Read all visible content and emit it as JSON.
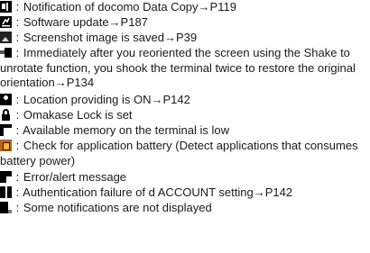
{
  "items": [
    {
      "icon": "docomo-data-copy-icon",
      "text": "Notification of docomo Data Copy→P119"
    },
    {
      "icon": "software-update-icon",
      "text": "Software update→P187"
    },
    {
      "icon": "screenshot-icon",
      "text": "Screenshot image is saved→P39"
    },
    {
      "icon": "shake-rotate-icon",
      "text": "Immediately after you reoriented the screen using the Shake to unrotate function, you shook the terminal twice to restore the original orientation→P134"
    },
    {
      "icon": "location-providing-icon",
      "text": "Location providing is ON→P142"
    },
    {
      "icon": "omakase-lock-icon",
      "text": "Omakase Lock is set"
    },
    {
      "icon": "low-memory-icon",
      "text": "Available memory on the terminal is low"
    },
    {
      "icon": "battery-check-icon",
      "text": "Check for application battery (Detect applications that consumes battery power)"
    },
    {
      "icon": "error-alert-icon",
      "text": "Error/alert message"
    },
    {
      "icon": "auth-failure-icon",
      "text": "Authentication failure of d ACCOUNT setting→P142"
    },
    {
      "icon": "hidden-notifications-icon",
      "text": "Some notifications are not displayed"
    }
  ],
  "separator": ":"
}
